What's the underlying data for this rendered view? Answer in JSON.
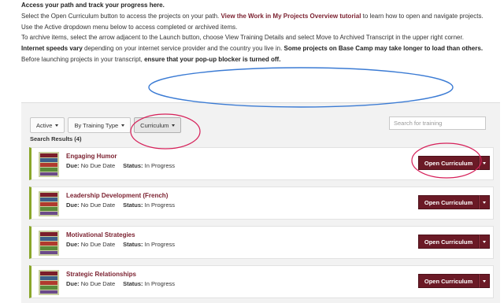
{
  "intro": {
    "heading": "Access your path and track your progress here.",
    "line1_pre": "Select the Open Curriculum button to access the projects on your path. ",
    "line1_link": "View the Work in My Projects Overview tutorial",
    "line1_post": " to learn how to open and navigate projects.",
    "line2": "Use the Active dropdown menu below to access completed or archived items.",
    "line3": "To archive items, select the arrow adjacent to the Launch button, choose View Training Details and select Move to Archived Transcript in the upper right corner.",
    "line4_bold1": "Internet speeds vary",
    "line4_mid": " depending on your internet service provider and the country you live in. ",
    "line4_bold2": "Some projects on Base Camp may take longer to load than others.",
    "line5_pre": "Before launching projects in your transcript, ",
    "line5_bold": "ensure that your pop-up blocker is turned off."
  },
  "filters": {
    "status": "Active",
    "type": "By Training Type",
    "category": "Curriculum"
  },
  "search": {
    "placeholder": "Search for training"
  },
  "results_label": "Search Results (4)",
  "labels": {
    "due": "Due:",
    "status": "Status:"
  },
  "items": [
    {
      "title": "Engaging Humor",
      "due": "No Due Date",
      "status": "In Progress",
      "button": "Open Curriculum"
    },
    {
      "title": "Leadership Development (French)",
      "due": "No Due Date",
      "status": "In Progress",
      "button": "Open Curriculum"
    },
    {
      "title": "Motivational Strategies",
      "due": "No Due Date",
      "status": "In Progress",
      "button": "Open Curriculum"
    },
    {
      "title": "Strategic Relationships",
      "due": "No Due Date",
      "status": "In Progress",
      "button": "Open Curriculum"
    }
  ],
  "colors": {
    "accent": "#6b1a26",
    "title": "#7a1f2e",
    "row_accent": "#8aa62a",
    "annotation_blue": "#3b7bd4",
    "annotation_pink": "#d6215a"
  }
}
